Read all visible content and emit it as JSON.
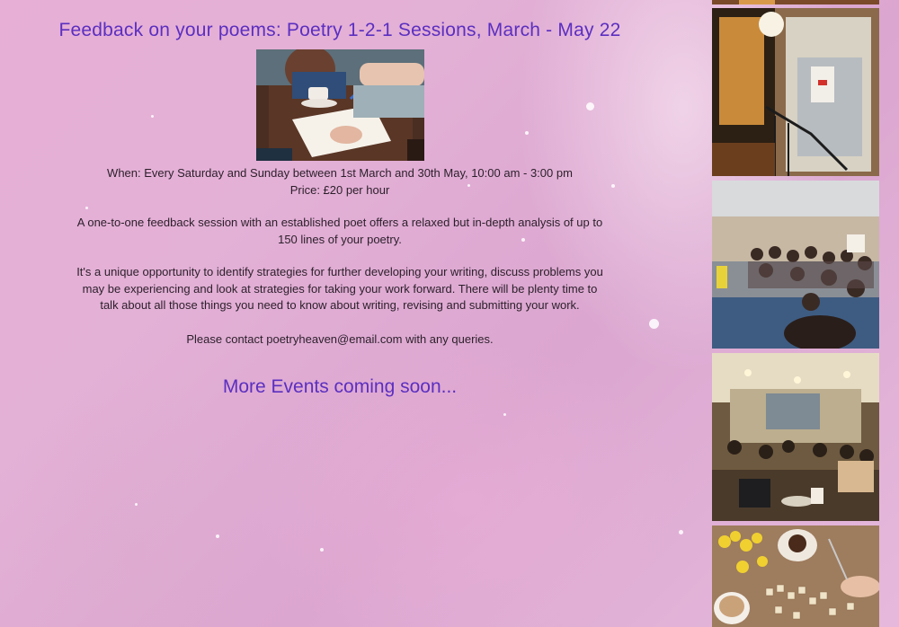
{
  "event": {
    "title": "Feedback on your poems: Poetry 1-2-1 Sessions, March - May 22",
    "photo_icon": "feedback-session-photo",
    "when": "When: Every Saturday and Sunday between 1st March and 30th May, 10:00 am - 3:00 pm",
    "price": "Price: £20 per hour",
    "description_1a": "A one-to-one feedback session with an established poet offers a relaxed but in-depth analysis of up to",
    "description_1b": "150 lines of your poetry.",
    "description_2a": "It's a unique opportunity to identify strategies for further developing your writing, discuss problems you",
    "description_2b": "may be experiencing and look at strategies for taking your work forward. There will be plenty time to",
    "description_2c": "talk about all those things you need to know about writing, revising and submitting your work.",
    "contact": "Please contact poetryheaven@email.com with any queries."
  },
  "more_events": "More Events coming soon...",
  "gallery": [
    {
      "icon": "venue-entrance-photo"
    },
    {
      "icon": "audience-reading-photo"
    },
    {
      "icon": "cafe-event-photo"
    },
    {
      "icon": "scrabble-coffee-photo"
    }
  ],
  "colors": {
    "accent": "#5b2fc0",
    "background": "#e3b0d6",
    "text": "#2b1f2a"
  }
}
